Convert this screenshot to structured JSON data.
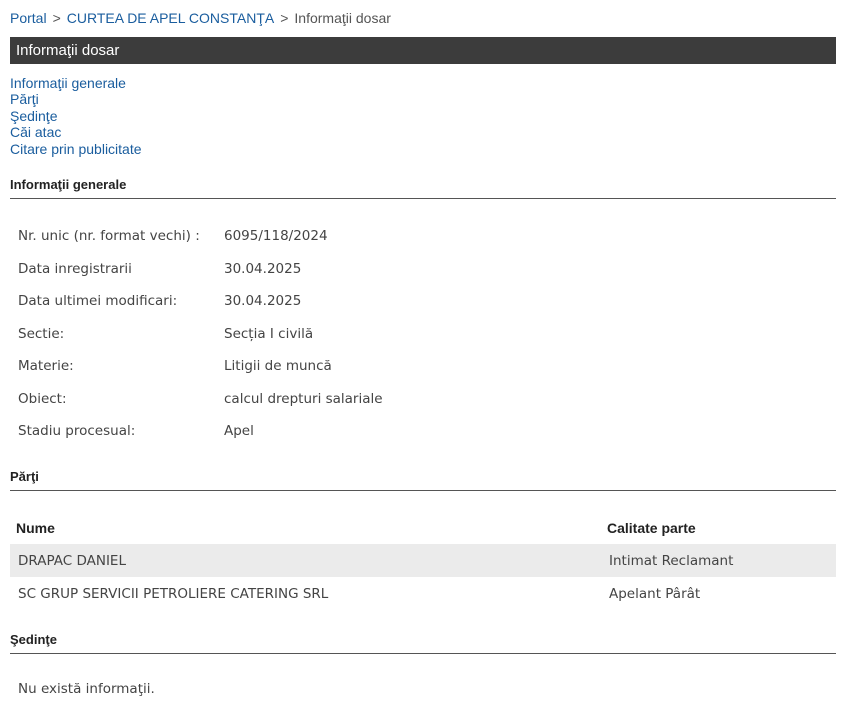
{
  "breadcrumb": {
    "portal": "Portal",
    "court": "CURTEA DE APEL CONSTANŢA",
    "current": "Informaţii dosar",
    "separator": ">"
  },
  "title": "Informaţii dosar",
  "nav": [
    "Informaţii generale",
    "Părţi",
    "Şedinţe",
    "Căi atac",
    "Citare prin publicitate"
  ],
  "general": {
    "heading": "Informaţii generale",
    "rows": [
      {
        "label": "Nr. unic (nr. format vechi) :",
        "value": "6095/118/2024"
      },
      {
        "label": "Data inregistrarii",
        "value": "30.04.2025"
      },
      {
        "label": "Data ultimei modificari:",
        "value": "30.04.2025"
      },
      {
        "label": "Sectie:",
        "value": "Secția I civilă"
      },
      {
        "label": "Materie:",
        "value": "Litigii de muncă"
      },
      {
        "label": "Obiect:",
        "value": "calcul drepturi salariale"
      },
      {
        "label": "Stadiu procesual:",
        "value": "Apel"
      }
    ]
  },
  "parti": {
    "heading": "Părţi",
    "columns": [
      "Nume",
      "Calitate parte"
    ],
    "rows": [
      {
        "name": "DRAPAC DANIEL",
        "role": "Intimat Reclamant"
      },
      {
        "name": "SC GRUP SERVICII PETROLIERE CATERING SRL",
        "role": "Apelant Pârât"
      }
    ]
  },
  "sedinte": {
    "heading": "Şedinţe",
    "empty_text": "Nu există informaţii."
  }
}
